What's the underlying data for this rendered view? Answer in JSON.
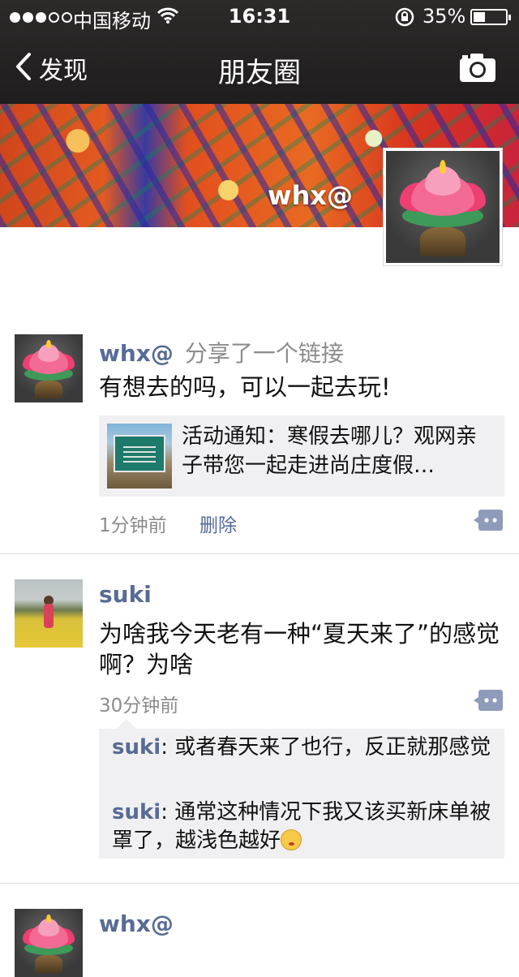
{
  "status_bar": {
    "carrier": "中国移动",
    "time": "16:31",
    "battery": "35%",
    "signal_bars_on": 3,
    "signal_bars_total": 5
  },
  "nav": {
    "back_label": "发现",
    "title": "朋友圈"
  },
  "profile": {
    "name": "whx@"
  },
  "posts": [
    {
      "author": "whx@",
      "action": "分享了一个链接",
      "text": "有想去的吗，可以一起去玩!",
      "link": {
        "title": "活动通知：寒假去哪儿？观网亲子带您一起走进尚庄度假…"
      },
      "time": "1分钟前",
      "delete_label": "删除"
    },
    {
      "author": "suki",
      "text": "为啥我今天老有一种“夏天来了”的感觉啊？为啥",
      "time": "30分钟前",
      "comments": [
        {
          "author": "suki",
          "sep": ": ",
          "text": "或者春天来了也行，反正就那感觉"
        },
        {
          "author": "suki",
          "sep": ": ",
          "text": "通常这种情况下我又该买新床单被罩了，越浅色越好"
        }
      ]
    },
    {
      "author": "whx@"
    }
  ],
  "colors": {
    "link_blue": "#576b95",
    "meta_gray": "#8c8c8c",
    "nav_bg": "#262323",
    "card_bg": "#f0f0f2"
  },
  "icons": [
    "back-chevron-icon",
    "camera-icon",
    "wifi-icon",
    "rotation-lock-icon",
    "battery-icon",
    "comment-bubble-icon",
    "smile-emoji-icon"
  ]
}
